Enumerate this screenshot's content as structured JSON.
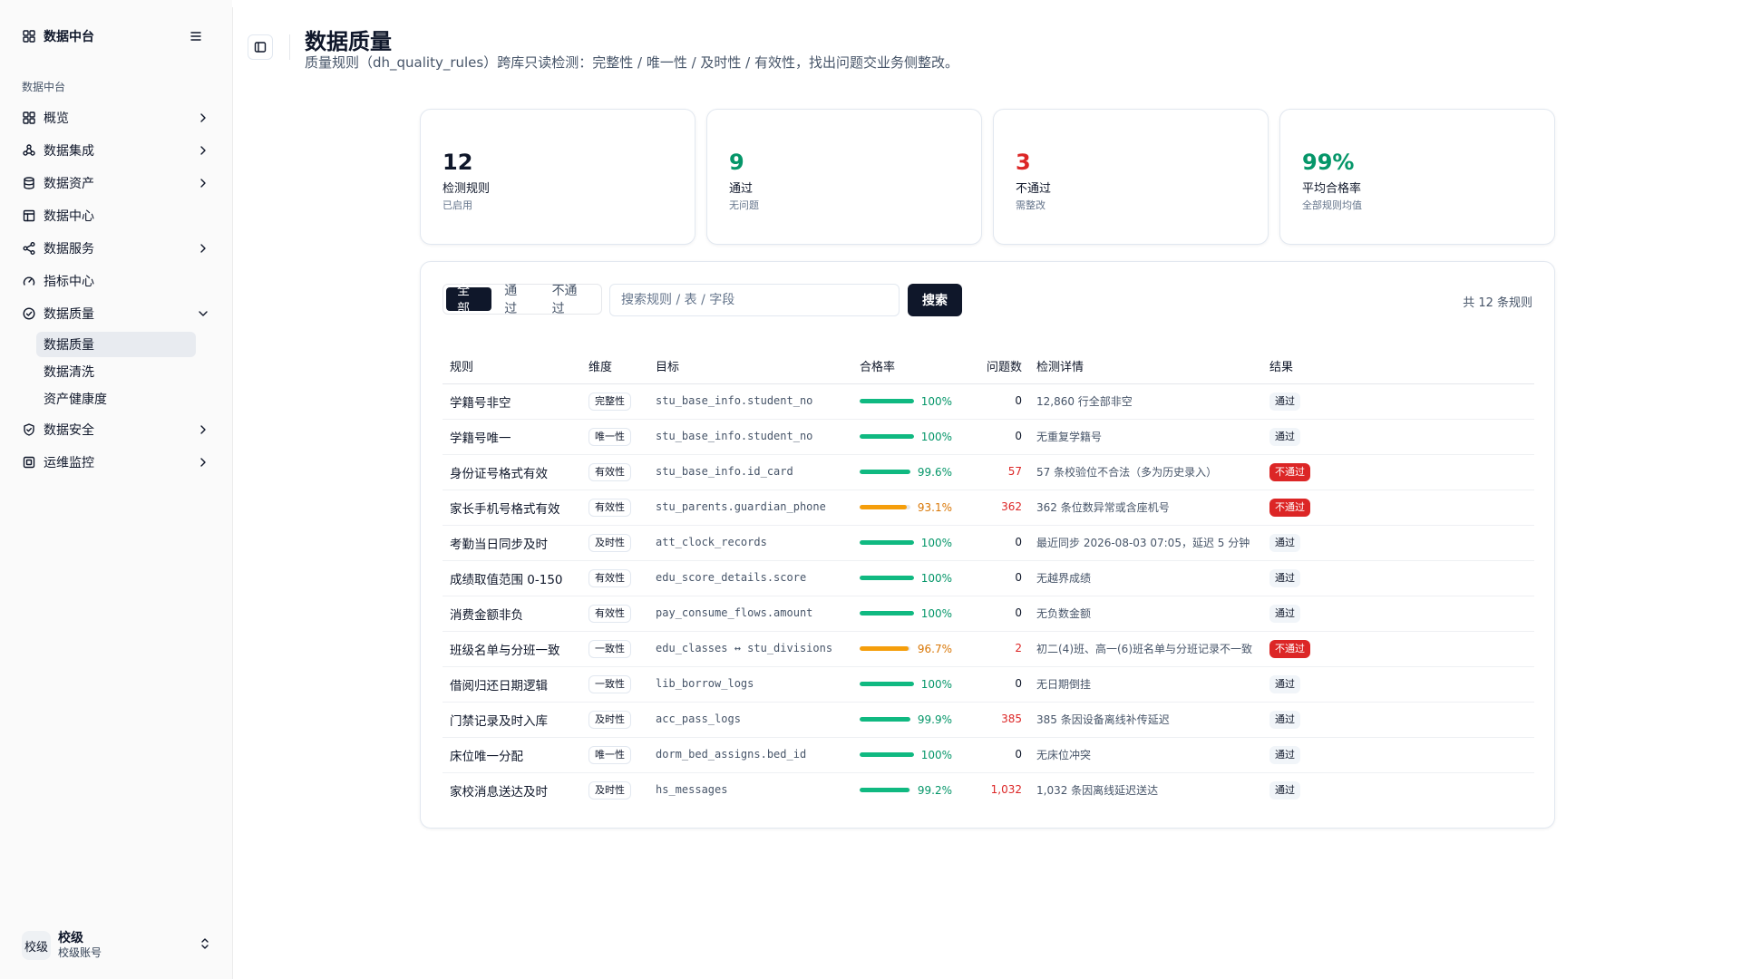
{
  "app": {
    "title": "数据中台"
  },
  "sidebar": {
    "group_label": "数据中台",
    "items": [
      {
        "label": "概览",
        "icon": "grid-icon",
        "chevron": "right"
      },
      {
        "label": "数据集成",
        "icon": "network-icon",
        "chevron": "right"
      },
      {
        "label": "数据资产",
        "icon": "database-icon",
        "chevron": "right"
      },
      {
        "label": "数据中心",
        "icon": "table-icon",
        "chevron": ""
      },
      {
        "label": "数据服务",
        "icon": "share-icon",
        "chevron": "right"
      },
      {
        "label": "指标中心",
        "icon": "gauge-icon",
        "chevron": ""
      },
      {
        "label": "数据质量",
        "icon": "check-circle-icon",
        "chevron": "down"
      }
    ],
    "sub_items": [
      {
        "label": "数据质量",
        "active": true
      },
      {
        "label": "数据清洗",
        "active": false
      },
      {
        "label": "资产健康度",
        "active": false
      }
    ],
    "items_after": [
      {
        "label": "数据安全",
        "icon": "shield-icon",
        "chevron": "right"
      },
      {
        "label": "运维监控",
        "icon": "monitor-icon",
        "chevron": "right"
      }
    ],
    "user": {
      "avatar_text": "校级",
      "name": "校级",
      "subtitle": "校级账号"
    }
  },
  "header": {
    "title": "数据质量",
    "description": "质量规则（dh_quality_rules）跨库只读检测：完整性 / 唯一性 / 及时性 / 有效性，找出问题交业务侧整改。"
  },
  "stats": [
    {
      "value": "12",
      "label": "检测规则",
      "hint": "已启用",
      "color": "#0f172a"
    },
    {
      "value": "9",
      "label": "通过",
      "hint": "无问题",
      "color": "#059669"
    },
    {
      "value": "3",
      "label": "不通过",
      "hint": "需整改",
      "color": "#dc2626"
    },
    {
      "value": "99%",
      "label": "平均合格率",
      "hint": "全部规则均值",
      "color": "#059669"
    }
  ],
  "filters": {
    "tabs": [
      {
        "label": "全部",
        "active": true
      },
      {
        "label": "通过",
        "active": false
      },
      {
        "label": "不通过",
        "active": false
      }
    ],
    "search_placeholder": "搜索规则 / 表 / 字段",
    "search_value": "",
    "search_button": "搜索",
    "total": "共 12 条规则"
  },
  "table": {
    "columns": [
      "规则",
      "维度",
      "目标",
      "合格率",
      "问题数",
      "检测详情",
      "结果"
    ],
    "rows": [
      {
        "rule": "学籍号非空",
        "dimension": "完整性",
        "target": "stu_base_info.student_no",
        "rate": "100%",
        "rate_value": 100,
        "bar_color": "#10b981",
        "issues": "0",
        "detail": "12,860 行全部非空",
        "result": "通过",
        "status": "pass"
      },
      {
        "rule": "学籍号唯一",
        "dimension": "唯一性",
        "target": "stu_base_info.student_no",
        "rate": "100%",
        "rate_value": 100,
        "bar_color": "#10b981",
        "issues": "0",
        "detail": "无重复学籍号",
        "result": "通过",
        "status": "pass"
      },
      {
        "rule": "身份证号格式有效",
        "dimension": "有效性",
        "target": "stu_base_info.id_card",
        "rate": "99.6%",
        "rate_value": 99.6,
        "bar_color": "#10b981",
        "issues": "57",
        "detail": "57 条校验位不合法（多为历史录入）",
        "result": "不通过",
        "status": "fail"
      },
      {
        "rule": "家长手机号格式有效",
        "dimension": "有效性",
        "target": "stu_parents.guardian_phone",
        "rate": "93.1%",
        "rate_value": 93.1,
        "bar_color": "#f59e0b",
        "issues": "362",
        "detail": "362 条位数异常或含座机号",
        "result": "不通过",
        "status": "fail"
      },
      {
        "rule": "考勤当日同步及时",
        "dimension": "及时性",
        "target": "att_clock_records",
        "rate": "100%",
        "rate_value": 100,
        "bar_color": "#10b981",
        "issues": "0",
        "detail": "最近同步 2026-08-03 07:05，延迟 5 分钟",
        "result": "通过",
        "status": "pass"
      },
      {
        "rule": "成绩取值范围 0-150",
        "dimension": "有效性",
        "target": "edu_score_details.score",
        "rate": "100%",
        "rate_value": 100,
        "bar_color": "#10b981",
        "issues": "0",
        "detail": "无越界成绩",
        "result": "通过",
        "status": "pass"
      },
      {
        "rule": "消费金额非负",
        "dimension": "有效性",
        "target": "pay_consume_flows.amount",
        "rate": "100%",
        "rate_value": 100,
        "bar_color": "#10b981",
        "issues": "0",
        "detail": "无负数金额",
        "result": "通过",
        "status": "pass"
      },
      {
        "rule": "班级名单与分班一致",
        "dimension": "一致性",
        "target": "edu_classes ↔ stu_divisions",
        "rate": "96.7%",
        "rate_value": 96.7,
        "bar_color": "#f59e0b",
        "issues": "2",
        "detail": "初二(4)班、高一(6)班名单与分班记录不一致",
        "result": "不通过",
        "status": "fail"
      },
      {
        "rule": "借阅归还日期逻辑",
        "dimension": "一致性",
        "target": "lib_borrow_logs",
        "rate": "100%",
        "rate_value": 100,
        "bar_color": "#10b981",
        "issues": "0",
        "detail": "无日期倒挂",
        "result": "通过",
        "status": "pass"
      },
      {
        "rule": "门禁记录及时入库",
        "dimension": "及时性",
        "target": "acc_pass_logs",
        "rate": "99.9%",
        "rate_value": 99.9,
        "bar_color": "#10b981",
        "issues": "385",
        "detail": "385 条因设备离线补传延迟",
        "result": "通过",
        "status": "pass"
      },
      {
        "rule": "床位唯一分配",
        "dimension": "唯一性",
        "target": "dorm_bed_assigns.bed_id",
        "rate": "100%",
        "rate_value": 100,
        "bar_color": "#10b981",
        "issues": "0",
        "detail": "无床位冲突",
        "result": "通过",
        "status": "pass"
      },
      {
        "rule": "家校消息送达及时",
        "dimension": "及时性",
        "target": "hs_messages",
        "rate": "99.2%",
        "rate_value": 99.2,
        "bar_color": "#10b981",
        "issues": "1,032",
        "detail": "1,032 条因离线延迟送达",
        "result": "通过",
        "status": "pass"
      }
    ]
  },
  "colors": {
    "pass_text": "#059669",
    "warn_text": "#d97706",
    "issue_text": "#dc2626",
    "accent": "#0f172a"
  }
}
